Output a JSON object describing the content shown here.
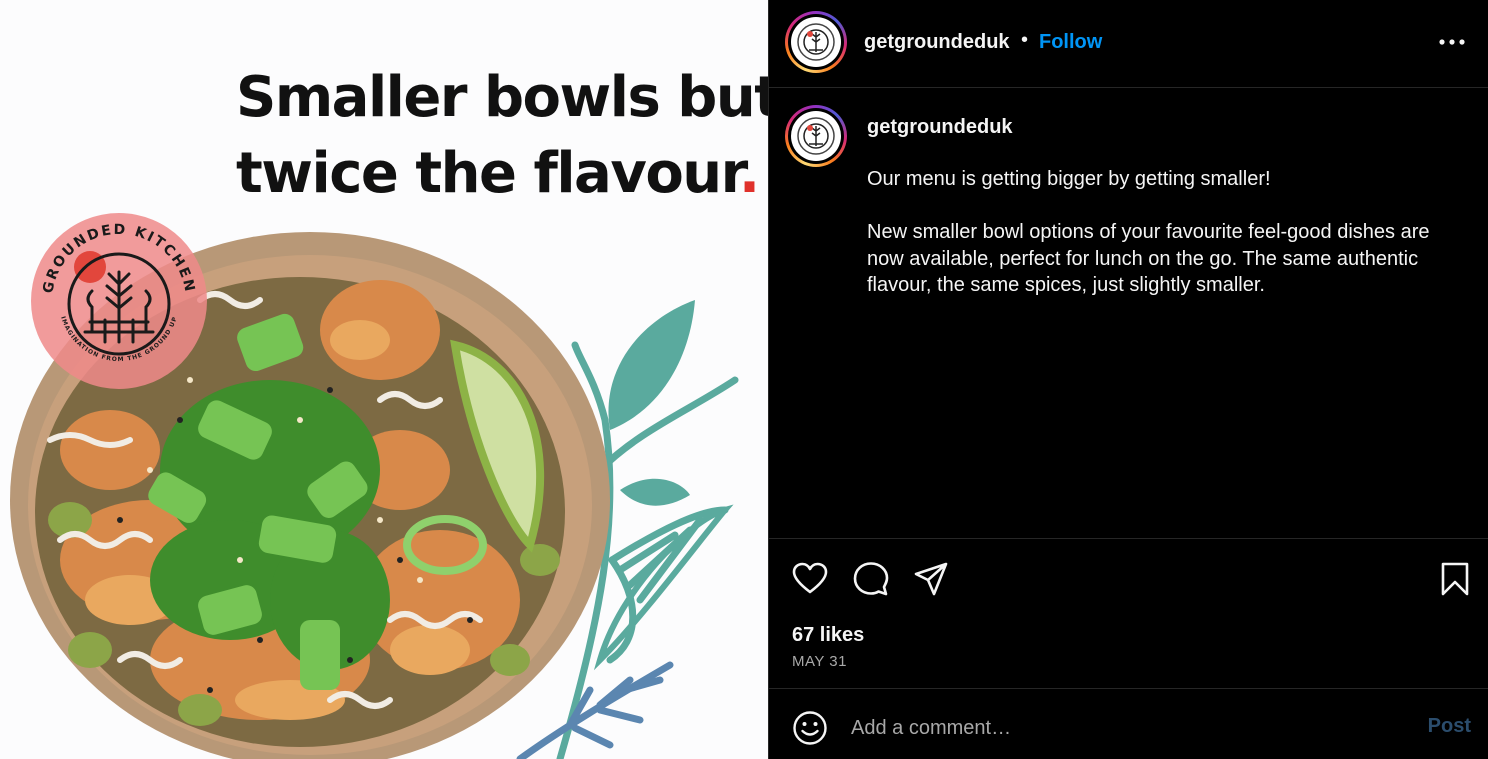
{
  "post_image": {
    "headline_line1": "Smaller bowls but",
    "headline_line2": "twice the flavour",
    "headline_dot": ".",
    "seal_brand": "GROUNDED KITCHEN",
    "seal_tagline": "IMAGINATION FROM THE GROUND UP"
  },
  "header": {
    "username": "getgroundeduk",
    "separator": "•",
    "follow_label": "Follow"
  },
  "caption": {
    "username": "getgroundeduk",
    "paragraph1": "Our menu is getting bigger by getting smaller!",
    "paragraph2": "New smaller bowl options of your favourite feel-good dishes are now available, perfect for lunch on the go. The same authentic flavour, the same spices, just slightly smaller."
  },
  "actions": {
    "icons": [
      "heart-icon",
      "comment-icon",
      "share-icon",
      "bookmark-icon"
    ],
    "likes": "67 likes",
    "date": "MAY 31"
  },
  "comment": {
    "placeholder": "Add a comment…",
    "post_label": "Post"
  },
  "colors": {
    "follow": "#0095f6",
    "post_disabled": "#2b4d6d",
    "headline_dot": "#e0312b",
    "leaf_teal": "#5aaa9e",
    "leaf_blue": "#5b86b0",
    "seal_pink": "#ef8a8a"
  }
}
